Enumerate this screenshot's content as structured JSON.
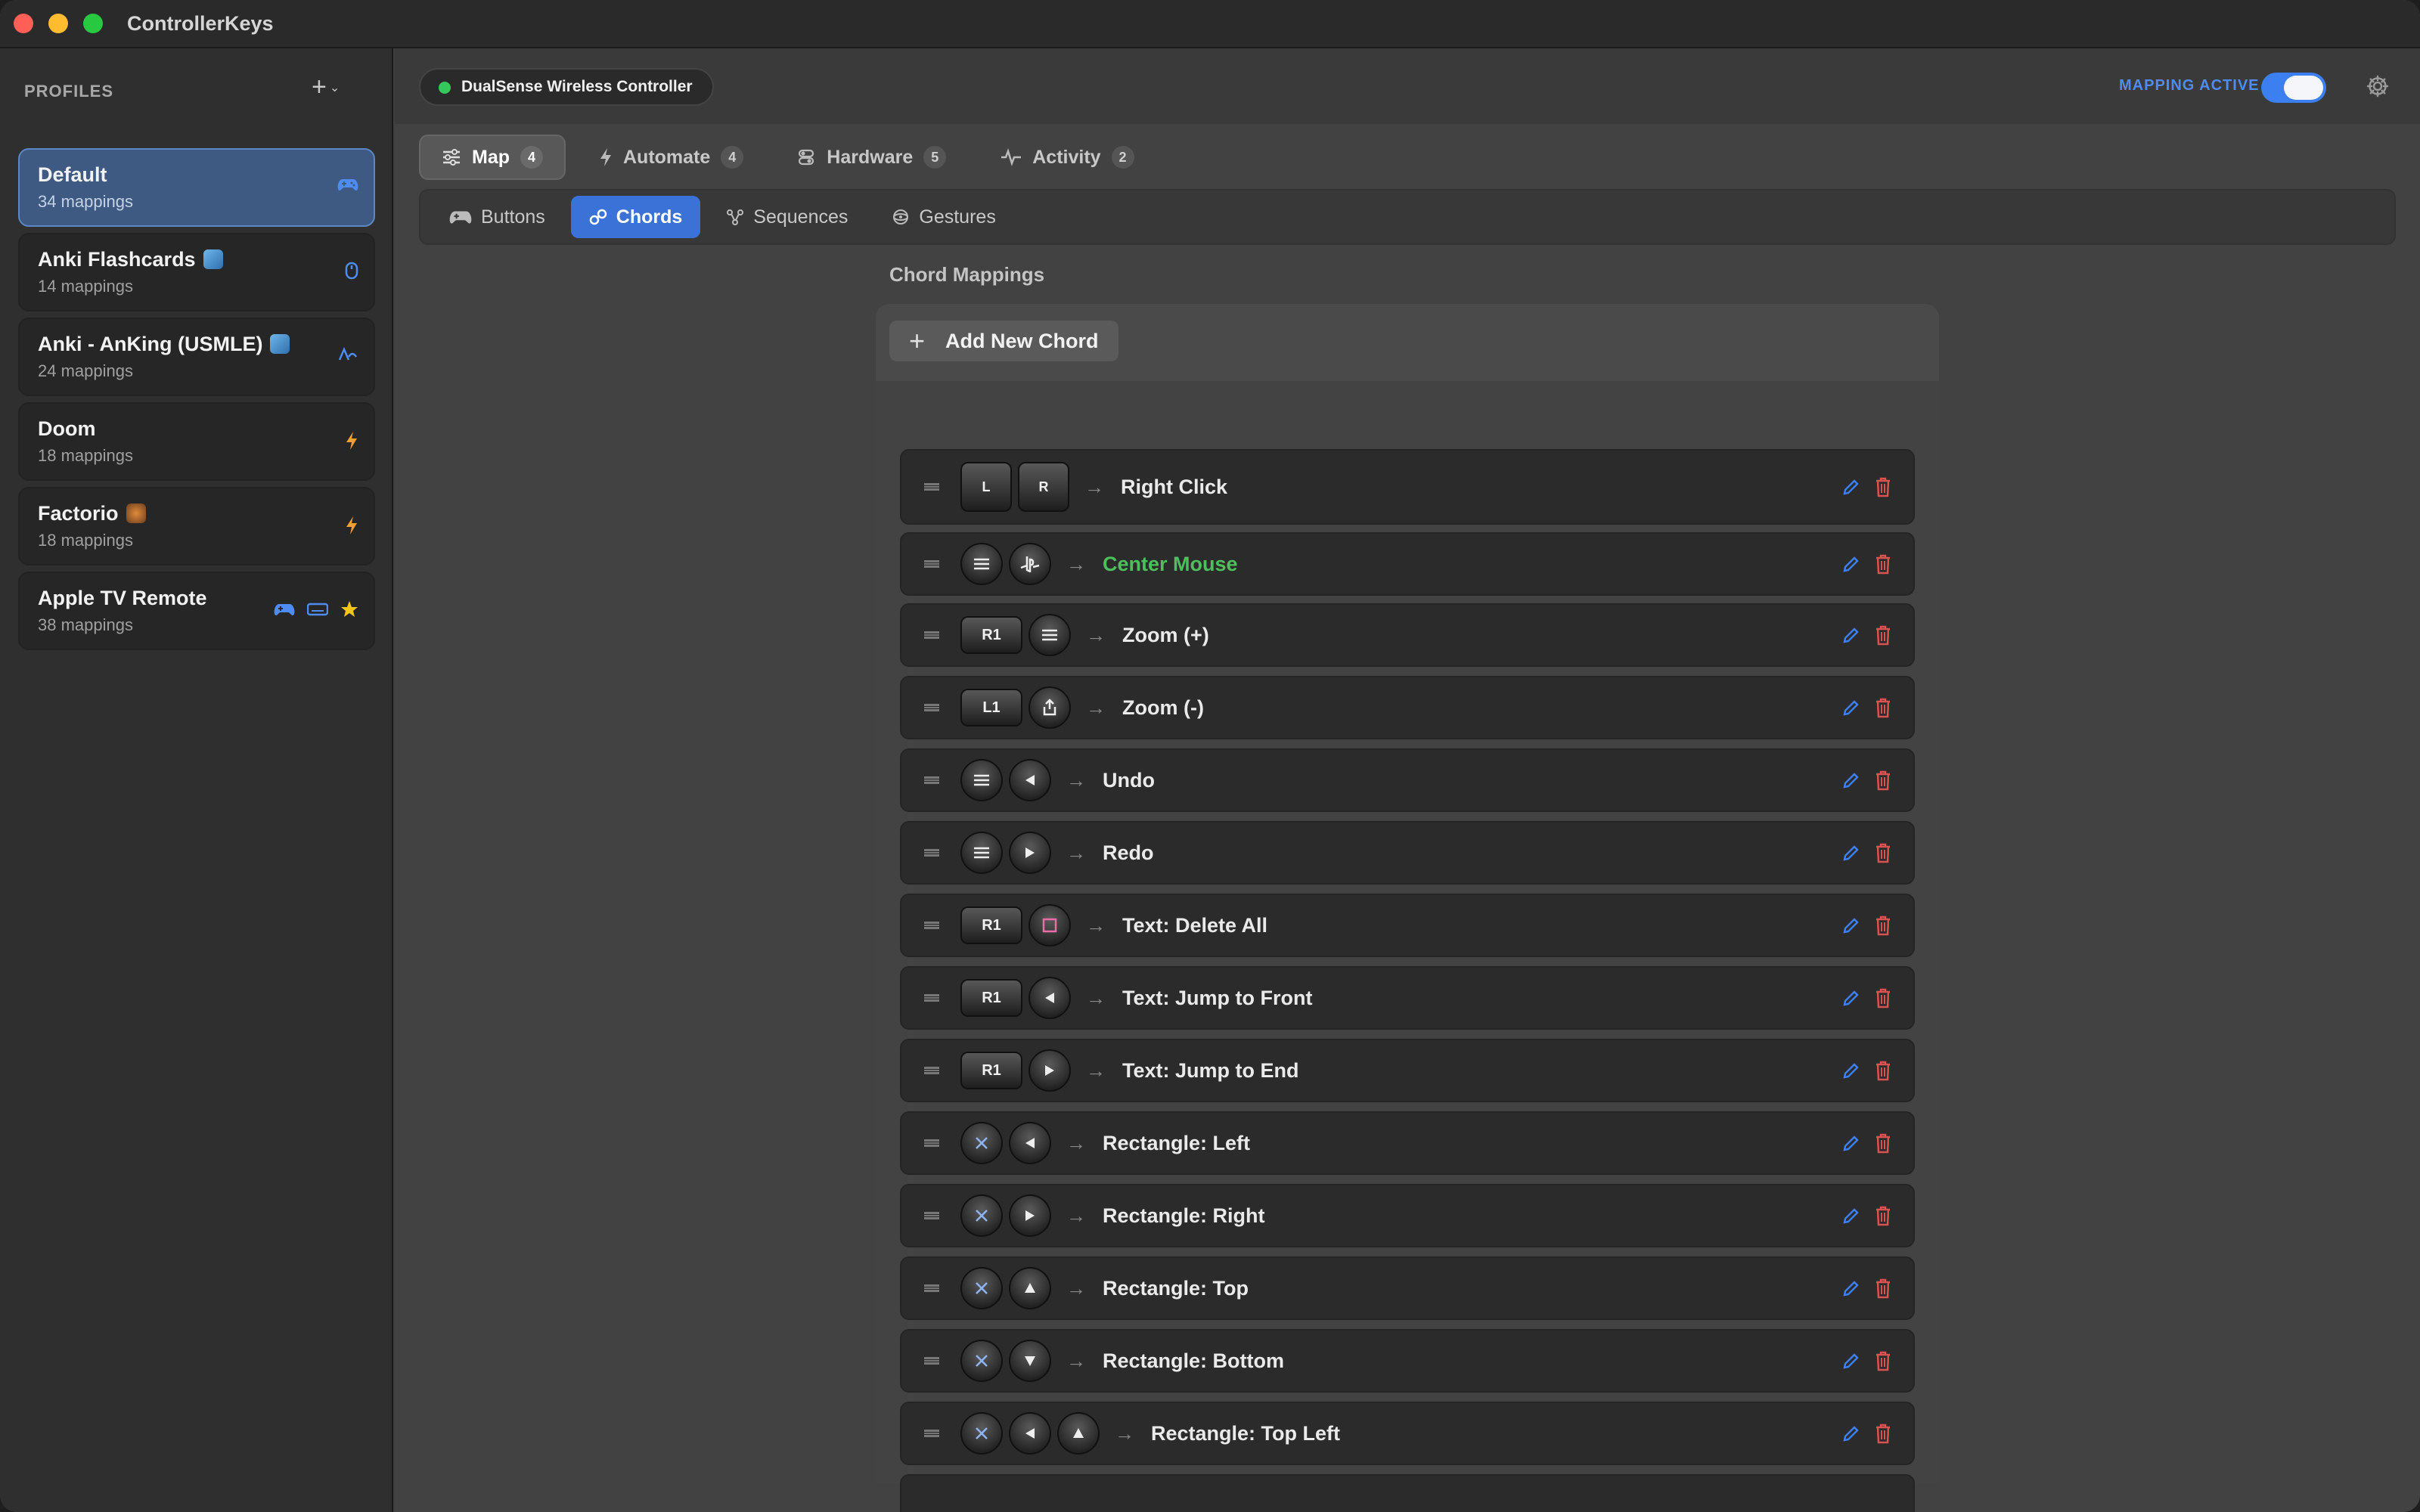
{
  "app": {
    "title": "ControllerKeys"
  },
  "sidebar": {
    "header": "PROFILES",
    "add_icon": "plus-icon",
    "profiles": [
      {
        "name": "Default",
        "count": "34 mappings",
        "active": true,
        "icons": [
          "gamepad-icon"
        ]
      },
      {
        "name": "Anki Flashcards",
        "count": "14 mappings",
        "emoji": "card-emoji",
        "icons": [
          "mouse-icon"
        ]
      },
      {
        "name": "Anki - AnKing (USMLE)",
        "count": "24 mappings",
        "emoji": "card-emoji",
        "icons": [
          "gesture-icon"
        ]
      },
      {
        "name": "Doom",
        "count": "18 mappings",
        "icons": [
          "bolt-icon"
        ]
      },
      {
        "name": "Factorio",
        "count": "18 mappings",
        "emoji": "gear-emoji",
        "icons": [
          "bolt-icon"
        ]
      },
      {
        "name": "Apple TV Remote",
        "count": "38 mappings",
        "icons": [
          "gamepad-icon",
          "keyboard-icon",
          "star-icon"
        ]
      }
    ]
  },
  "topbar": {
    "device": "DualSense Wireless Controller",
    "device_status_color": "#34c759",
    "mapping_label": "MAPPING ACTIVE",
    "mapping_active": true,
    "accent": "#3b7ff0"
  },
  "tabs": [
    {
      "label": "Map",
      "count": "4",
      "icon": "sliders-icon",
      "active": true
    },
    {
      "label": "Automate",
      "count": "4",
      "icon": "bolt-icon"
    },
    {
      "label": "Hardware",
      "count": "5",
      "icon": "toggle-icon"
    },
    {
      "label": "Activity",
      "count": "2",
      "icon": "pulse-icon"
    }
  ],
  "subtabs": [
    {
      "label": "Buttons",
      "icon": "gamepad-icon"
    },
    {
      "label": "Chords",
      "icon": "link-icon",
      "active": true
    },
    {
      "label": "Sequences",
      "icon": "nodes-icon"
    },
    {
      "label": "Gestures",
      "icon": "gyro-icon"
    }
  ],
  "chords": {
    "title": "Chord Mappings",
    "add_label": "Add New Chord",
    "rows": [
      {
        "buttons": [
          "LS",
          "RS"
        ],
        "button_labels": [
          "L",
          "R"
        ],
        "action": "Right Click"
      },
      {
        "buttons": [
          "Options",
          "PS"
        ],
        "action": "Center Mouse",
        "highlight": true
      },
      {
        "buttons": [
          "R1",
          "Options"
        ],
        "button_labels": [
          "R1",
          ""
        ],
        "action": "Zoom (+)"
      },
      {
        "buttons": [
          "L1",
          "Share"
        ],
        "button_labels": [
          "L1",
          ""
        ],
        "action": "Zoom (-)"
      },
      {
        "buttons": [
          "Options",
          "Left"
        ],
        "action": "Undo"
      },
      {
        "buttons": [
          "Options",
          "Right"
        ],
        "action": "Redo"
      },
      {
        "buttons": [
          "R1",
          "Square"
        ],
        "button_labels": [
          "R1",
          ""
        ],
        "action": "Text: Delete All"
      },
      {
        "buttons": [
          "R1",
          "Left"
        ],
        "button_labels": [
          "R1",
          ""
        ],
        "action": "Text: Jump to Front"
      },
      {
        "buttons": [
          "R1",
          "Right"
        ],
        "button_labels": [
          "R1",
          ""
        ],
        "action": "Text: Jump to End"
      },
      {
        "buttons": [
          "Cross",
          "Left"
        ],
        "action": "Rectangle: Left"
      },
      {
        "buttons": [
          "Cross",
          "Right"
        ],
        "action": "Rectangle: Right"
      },
      {
        "buttons": [
          "Cross",
          "Up"
        ],
        "action": "Rectangle: Top"
      },
      {
        "buttons": [
          "Cross",
          "Down"
        ],
        "action": "Rectangle: Bottom"
      },
      {
        "buttons": [
          "Cross",
          "Left",
          "Up"
        ],
        "action": "Rectangle: Top Left"
      }
    ],
    "edit_icon": "pencil-icon",
    "delete_icon": "trash-icon",
    "edit_color": "#3b7ff0",
    "delete_color": "#d9534f",
    "highlight_color": "#4cc05a"
  }
}
